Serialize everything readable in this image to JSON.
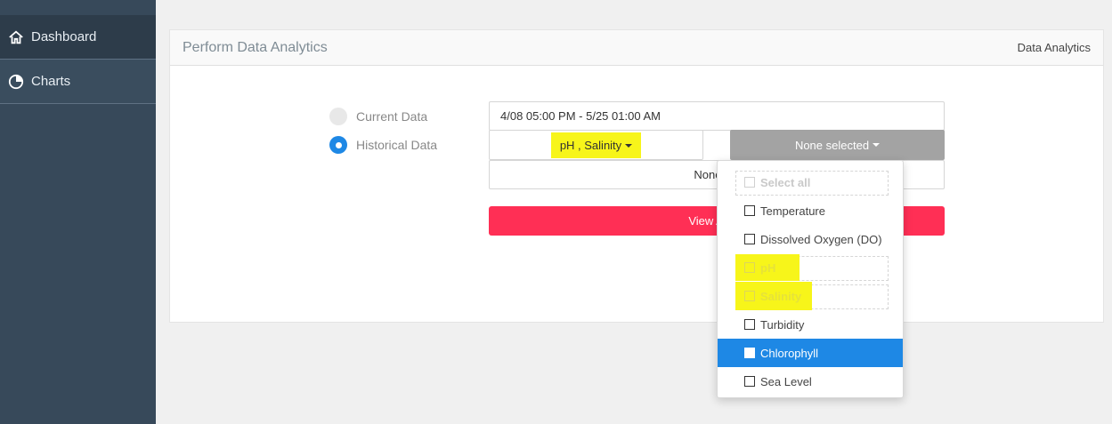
{
  "sidebar": {
    "items": [
      {
        "label": "Dashboard",
        "icon": "home-icon"
      },
      {
        "label": "Charts",
        "icon": "pie-chart-icon"
      }
    ]
  },
  "panel": {
    "title": "Perform Data Analytics",
    "breadcrumb": "Data Analytics"
  },
  "form": {
    "radio_current": "Current Data",
    "radio_historical": "Historical Data",
    "selected_radio": "Historical Data",
    "date_range": "4/08 05:00 PM - 5/25 01:00 AM",
    "parameters_value": "pH , Salinity",
    "second_select": "None selected",
    "third_select": "None sel",
    "view_button": "View Analy"
  },
  "dropdown": {
    "items": [
      {
        "label": "Select all",
        "checked": false
      },
      {
        "label": "Temperature",
        "checked": false
      },
      {
        "label": "Dissolved Oxygen (DO)",
        "checked": false
      },
      {
        "label": "pH",
        "checked": false
      },
      {
        "label": "Salinity",
        "checked": false
      },
      {
        "label": "Turbidity",
        "checked": false
      },
      {
        "label": "Chlorophyll",
        "checked": false
      },
      {
        "label": "Sea Level",
        "checked": false
      }
    ]
  },
  "colors": {
    "sidebar": "#37495a",
    "accent_blue": "#1e88e5",
    "view_button": "#ff2f55",
    "highlight": "#f7f51a"
  }
}
